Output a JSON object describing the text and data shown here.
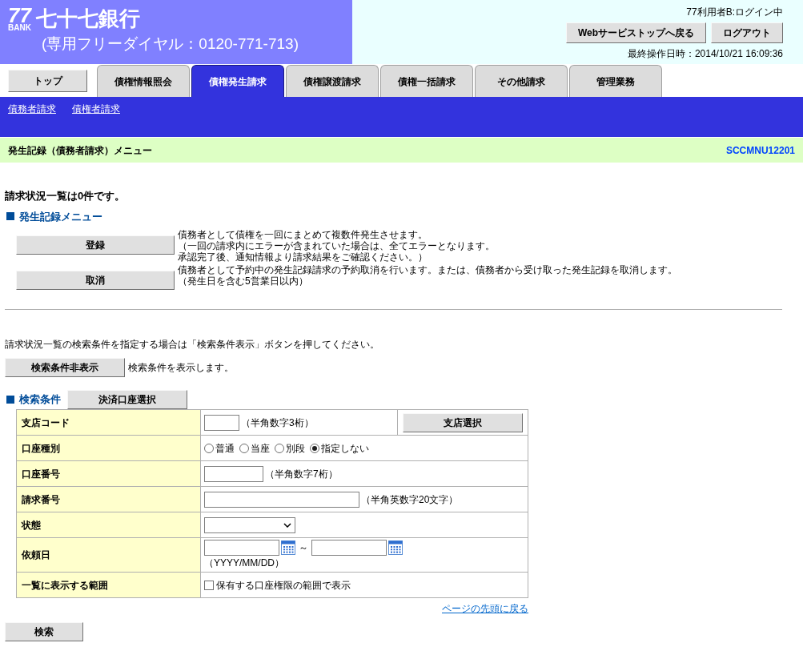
{
  "header": {
    "logo_mark": "77",
    "logo_sub": "BANK",
    "bank_name": "七十七銀行",
    "phone": "(専用フリーダイヤル：0120-771-713)",
    "user_status": "77利用者B:ログイン中",
    "buttons": [
      "Webサービストップへ戻る",
      "ログアウト"
    ],
    "last_operation": "最終操作日時：2014/10/21 16:09:36"
  },
  "top_button": "トップ",
  "tabs": [
    {
      "label": "債権情報照会",
      "selected": false
    },
    {
      "label": "債権発生請求",
      "selected": true
    },
    {
      "label": "債権譲渡請求",
      "selected": false
    },
    {
      "label": "債権一括請求",
      "selected": false
    },
    {
      "label": "その他請求",
      "selected": false
    },
    {
      "label": "管理業務",
      "selected": false
    }
  ],
  "sub_links": [
    "債務者請求",
    "債権者請求"
  ],
  "page_title": "発生記録（債務者請求）メニュー",
  "screen_id": "SCCMNU12201",
  "status_message": "請求状況一覧は0件です。",
  "menu_heading": "発生記録メニュー",
  "menu_items": [
    {
      "button": "登録",
      "description": [
        "債務者として債権を一回にまとめて複数件発生させます。",
        "（一回の請求内にエラーが含まれていた場合は、全てエラーとなります。",
        "承認完了後、通知情報より請求結果をご確認ください。）"
      ]
    },
    {
      "button": "取消",
      "description": [
        "債務者として予約中の発生記録請求の予約取消を行います。または、債務者から受け取った発生記録を取消します。",
        "（発生日を含む5営業日以内）"
      ]
    }
  ],
  "search_instruction": "請求状況一覧の検索条件を指定する場合は「検索条件表示」ボタンを押してください。",
  "toggle_button": "検索条件非表示",
  "toggle_note": "検索条件を表示します。",
  "conditions_heading": "検索条件",
  "account_button": "決済口座選択",
  "conditions": [
    {
      "kind": "short_text",
      "label": "支店コード",
      "hint": "（半角数字3桁）",
      "button": "支店選択"
    },
    {
      "kind": "radio",
      "label": "口座種別",
      "options": [
        {
          "label": "普通",
          "selected": false
        },
        {
          "label": "当座",
          "selected": false
        },
        {
          "label": "別段",
          "selected": false
        },
        {
          "label": "指定しない",
          "selected": true
        }
      ]
    },
    {
      "kind": "medium_text",
      "label": "口座番号",
      "hint": "（半角数字7桁）"
    },
    {
      "kind": "long_text",
      "label": "請求番号",
      "hint": "（半角英数字20文字）"
    },
    {
      "kind": "select",
      "label": "状態"
    },
    {
      "kind": "date_range",
      "label": "依頼日",
      "separator": "～",
      "hint": "（YYYY/MM/DD）"
    },
    {
      "kind": "checkbox",
      "label": "一覧に表示する範囲",
      "option": "保有する口座権限の範囲で表示",
      "checked": false
    }
  ],
  "back_to_top": "ページの先頭に戻る",
  "search_button": "検索"
}
